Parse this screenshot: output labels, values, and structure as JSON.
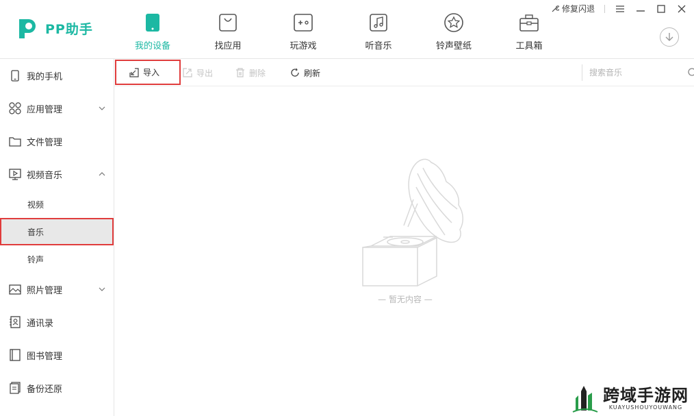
{
  "app": {
    "name": "PP助手",
    "brand_color": "#1cb8a3",
    "highlight_color": "#e03c3c"
  },
  "window": {
    "repair_label": "修复闪退",
    "menu_icon": "hamburger-icon",
    "minimize_icon": "minimize-icon",
    "maximize_icon": "maximize-icon",
    "close_icon": "close-icon"
  },
  "nav": {
    "items": [
      {
        "label": "我的设备",
        "icon": "phone-icon",
        "active": true
      },
      {
        "label": "找应用",
        "icon": "bag-icon",
        "active": false
      },
      {
        "label": "玩游戏",
        "icon": "gamepad-icon",
        "active": false
      },
      {
        "label": "听音乐",
        "icon": "music-note-icon",
        "active": false
      },
      {
        "label": "铃声壁纸",
        "icon": "star-icon",
        "active": false
      },
      {
        "label": "工具箱",
        "icon": "toolbox-icon",
        "active": false
      }
    ]
  },
  "sidebar": {
    "items": [
      {
        "label": "我的手机",
        "icon": "phone-outline-icon"
      },
      {
        "label": "应用管理",
        "icon": "apps-grid-icon"
      },
      {
        "label": "文件管理",
        "icon": "folder-icon"
      },
      {
        "label": "视频音乐",
        "icon": "media-screen-icon"
      },
      {
        "label": "照片管理",
        "icon": "photo-icon"
      },
      {
        "label": "通讯录",
        "icon": "contacts-icon"
      },
      {
        "label": "图书管理",
        "icon": "book-icon"
      },
      {
        "label": "备份还原",
        "icon": "backup-icon"
      }
    ],
    "sub_items": [
      {
        "label": "视频"
      },
      {
        "label": "音乐"
      },
      {
        "label": "铃声"
      }
    ]
  },
  "toolbar": {
    "import_label": "导入",
    "export_label": "导出",
    "delete_label": "删除",
    "refresh_label": "刷新",
    "search_placeholder": "搜索音乐"
  },
  "empty_state": {
    "text": "— 暂无内容 —"
  },
  "watermark": {
    "title": "跨域手游网",
    "subtitle": "KUAYUSHOUYOUWANG"
  }
}
